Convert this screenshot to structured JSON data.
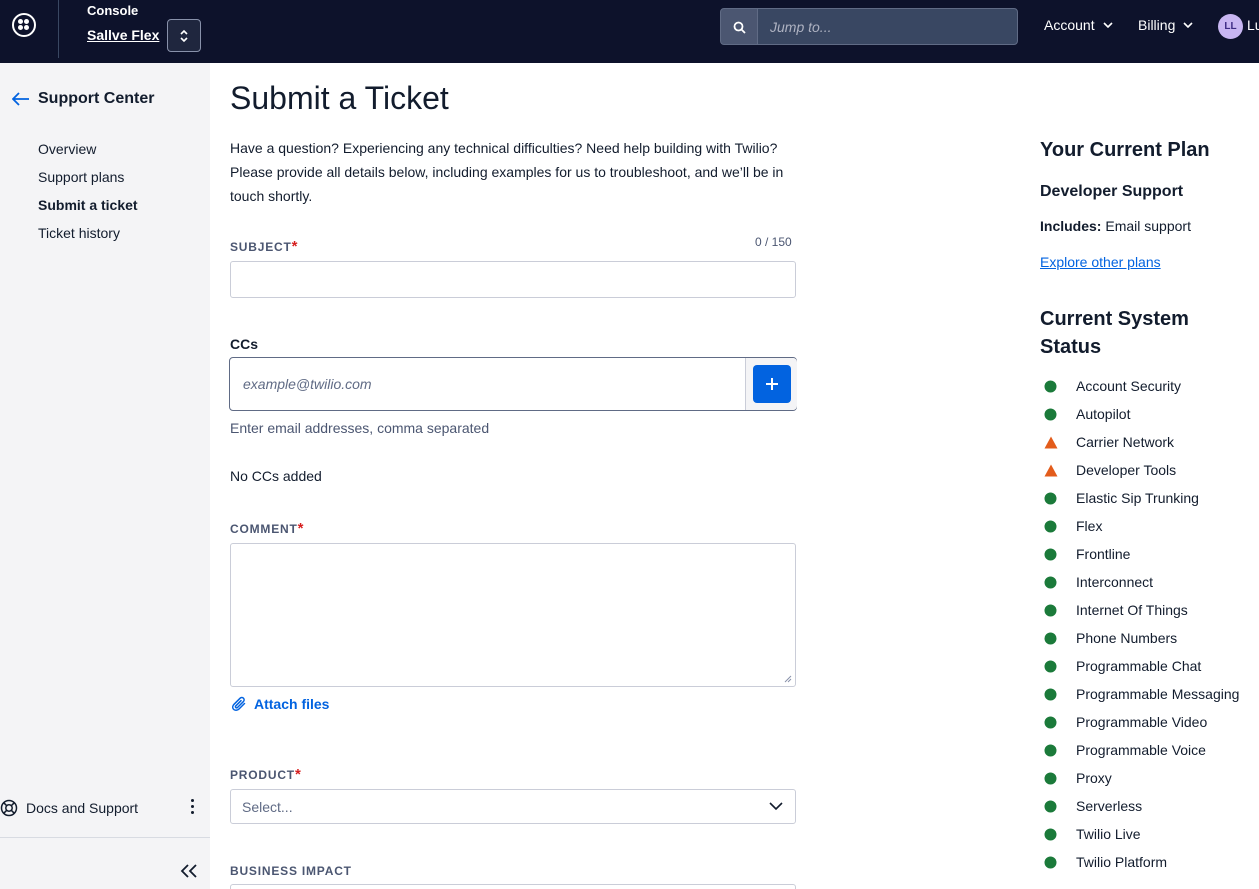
{
  "topbar": {
    "console_label": "Console",
    "account_name": "Sallve Flex",
    "search_placeholder": "Jump to...",
    "menus": [
      {
        "label": "Account"
      },
      {
        "label": "Billing"
      }
    ],
    "avatar_initials": "LL",
    "user_name_partial": "Lu"
  },
  "sidebar": {
    "title": "Support Center",
    "items": [
      {
        "label": "Overview",
        "active": false
      },
      {
        "label": "Support plans",
        "active": false
      },
      {
        "label": "Submit a ticket",
        "active": true
      },
      {
        "label": "Ticket history",
        "active": false
      }
    ],
    "docs_label": "Docs and Support"
  },
  "main": {
    "title": "Submit a Ticket",
    "intro": "Have a question? Experiencing any technical difficulties? Need help building with Twilio? Please provide all details below, including examples for us to troubleshoot, and we’ll be in touch shortly.",
    "subject": {
      "label": "SUBJECT",
      "required_mark": "*",
      "char_count": "0 / 150",
      "value": ""
    },
    "ccs": {
      "label": "CCs",
      "placeholder": "example@twilio.com",
      "help": "Enter email addresses, comma separated",
      "empty_text": "No CCs added"
    },
    "comment": {
      "label": "COMMENT",
      "required_mark": "*",
      "value": ""
    },
    "attach_label": "Attach files",
    "product": {
      "label": "PRODUCT",
      "required_mark": "*",
      "value": "Select..."
    },
    "business_impact": {
      "label": "BUSINESS IMPACT"
    }
  },
  "plan": {
    "heading": "Your Current Plan",
    "name": "Developer Support",
    "includes_label": "Includes:",
    "includes_value": "Email support",
    "explore_label": "Explore other plans"
  },
  "status": {
    "heading": "Current System Status",
    "colors": {
      "operational": "#1b7a3a",
      "degraded": "#e35c1b"
    },
    "items": [
      {
        "name": "Account Security",
        "state": "operational"
      },
      {
        "name": "Autopilot",
        "state": "operational"
      },
      {
        "name": "Carrier Network",
        "state": "degraded"
      },
      {
        "name": "Developer Tools",
        "state": "degraded"
      },
      {
        "name": "Elastic Sip Trunking",
        "state": "operational"
      },
      {
        "name": "Flex",
        "state": "operational"
      },
      {
        "name": "Frontline",
        "state": "operational"
      },
      {
        "name": "Interconnect",
        "state": "operational"
      },
      {
        "name": "Internet Of Things",
        "state": "operational"
      },
      {
        "name": "Phone Numbers",
        "state": "operational"
      },
      {
        "name": "Programmable Chat",
        "state": "operational"
      },
      {
        "name": "Programmable Messaging",
        "state": "operational"
      },
      {
        "name": "Programmable Video",
        "state": "operational"
      },
      {
        "name": "Programmable Voice",
        "state": "operational"
      },
      {
        "name": "Proxy",
        "state": "operational"
      },
      {
        "name": "Serverless",
        "state": "operational"
      },
      {
        "name": "Twilio Live",
        "state": "operational"
      },
      {
        "name": "Twilio Platform",
        "state": "operational"
      }
    ]
  }
}
